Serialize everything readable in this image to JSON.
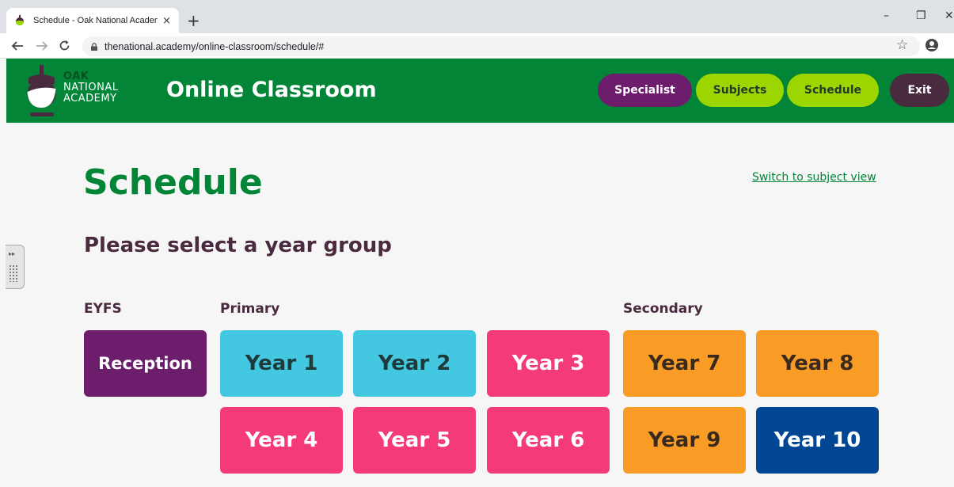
{
  "browser": {
    "tab_title": "Schedule - Oak National Academ",
    "tab_close": "×",
    "new_tab": "+",
    "url": "thenational.academy/online-classroom/schedule/#",
    "minimize": "–",
    "restore": "❐",
    "close": "✕"
  },
  "header": {
    "logo_line1": "OAK",
    "logo_line2": "NATIONAL",
    "logo_line3": "ACADEMY",
    "brand": "Online Classroom",
    "nav": {
      "specialist": "Specialist",
      "subjects": "Subjects",
      "schedule": "Schedule",
      "exit": "Exit"
    }
  },
  "main": {
    "title": "Schedule",
    "switch_link": "Switch to subject view",
    "subtitle": "Please select a year group",
    "groups": {
      "eyfs": "EYFS",
      "primary": "Primary",
      "secondary": "Secondary"
    },
    "years": {
      "reception": "Reception",
      "y1": "Year 1",
      "y2": "Year 2",
      "y3": "Year 3",
      "y4": "Year 4",
      "y5": "Year 5",
      "y6": "Year 6",
      "y7": "Year 7",
      "y8": "Year 8",
      "y9": "Year 9",
      "y10": "Year 10"
    }
  },
  "colors": {
    "brand_green": "#038537",
    "purple": "#6c1e6d",
    "lime": "#9bd600",
    "dark": "#4a2a3e",
    "cyan": "#44c8e2",
    "pink": "#f43a7a",
    "orange": "#f99c26",
    "navy": "#004692"
  }
}
